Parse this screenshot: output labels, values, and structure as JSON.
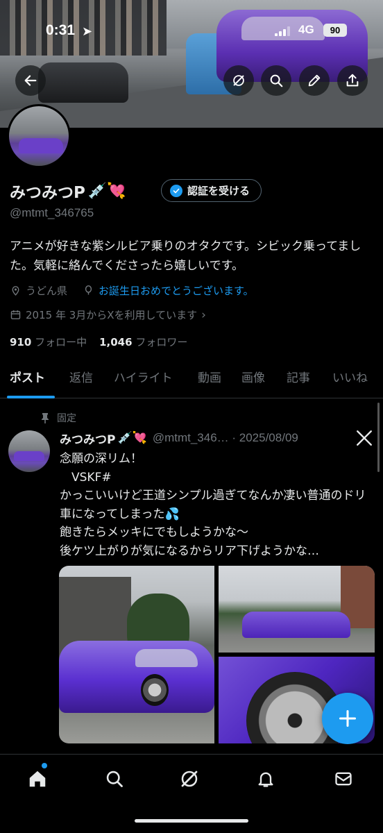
{
  "status_bar": {
    "time": "0:31",
    "network": "4G",
    "battery": "90"
  },
  "header": {
    "back_icon": "arrow-left-icon",
    "actions": [
      "grok-icon",
      "search-icon",
      "edit-icon",
      "share-icon"
    ]
  },
  "profile": {
    "name": "みつみつP",
    "name_emoji": "💉💘",
    "verify_label": "認証を受ける",
    "handle": "@mtmt_346765",
    "bio": "アニメが好きな紫シルビア乗りのオタクです。シビック乗ってました。気軽に絡んでくださったら嬉しいです。",
    "location": "うどん県",
    "birthday": "お誕生日おめでとうございます。",
    "joined": "2015 年 3月からXを利用しています",
    "following_count": "910",
    "following_label": "フォロー中",
    "followers_count": "1,046",
    "followers_label": "フォロワー"
  },
  "tabs": [
    "ポスト",
    "返信",
    "ハイライト",
    "動画",
    "画像",
    "記事",
    "いいね"
  ],
  "active_tab": "ポスト",
  "post": {
    "pinned_label": "固定",
    "author": "みつみつP",
    "author_emoji": "💉💘",
    "meta": "@mtmt_346… · 2025/08/09",
    "text": "念願の深リム！\n　VSKF#\nかっこいいけど王道シンプル過ぎてなんか凄い普通のドリ車になってしまった💦\n飽きたらメッキにでもしようかな〜\n後ケツ上がりが気になるからリア下げようかな…"
  },
  "bottom_nav": [
    "home-icon",
    "search-icon",
    "grok-icon",
    "notifications-icon",
    "messages-icon"
  ],
  "colors": {
    "accent": "#1d9bf0",
    "background": "#000000",
    "muted": "#71767b",
    "text": "#e7e9ea"
  }
}
